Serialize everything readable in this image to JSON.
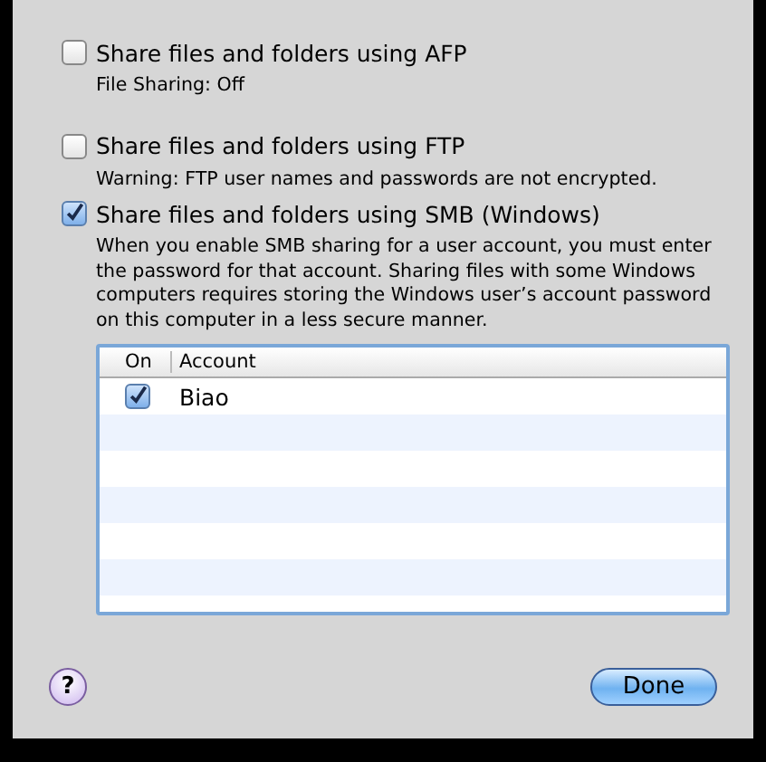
{
  "options": [
    {
      "label": "Share files and folders using AFP",
      "checked": false,
      "note": "File Sharing: Off"
    },
    {
      "label": "Share files and folders using FTP",
      "checked": false,
      "note": "Warning: FTP user names and passwords are not encrypted."
    },
    {
      "label": "Share files and folders using SMB (Windows)",
      "checked": true,
      "note": "When you enable SMB sharing for a user account, you must enter the password for that account. Sharing files with some Windows computers requires storing the Windows user’s account password on this computer in a less secure manner."
    }
  ],
  "table": {
    "columns": [
      "On",
      "Account"
    ],
    "rows": [
      {
        "on": true,
        "account": "Biao"
      }
    ]
  },
  "help_button": "?",
  "done_button": "Done"
}
